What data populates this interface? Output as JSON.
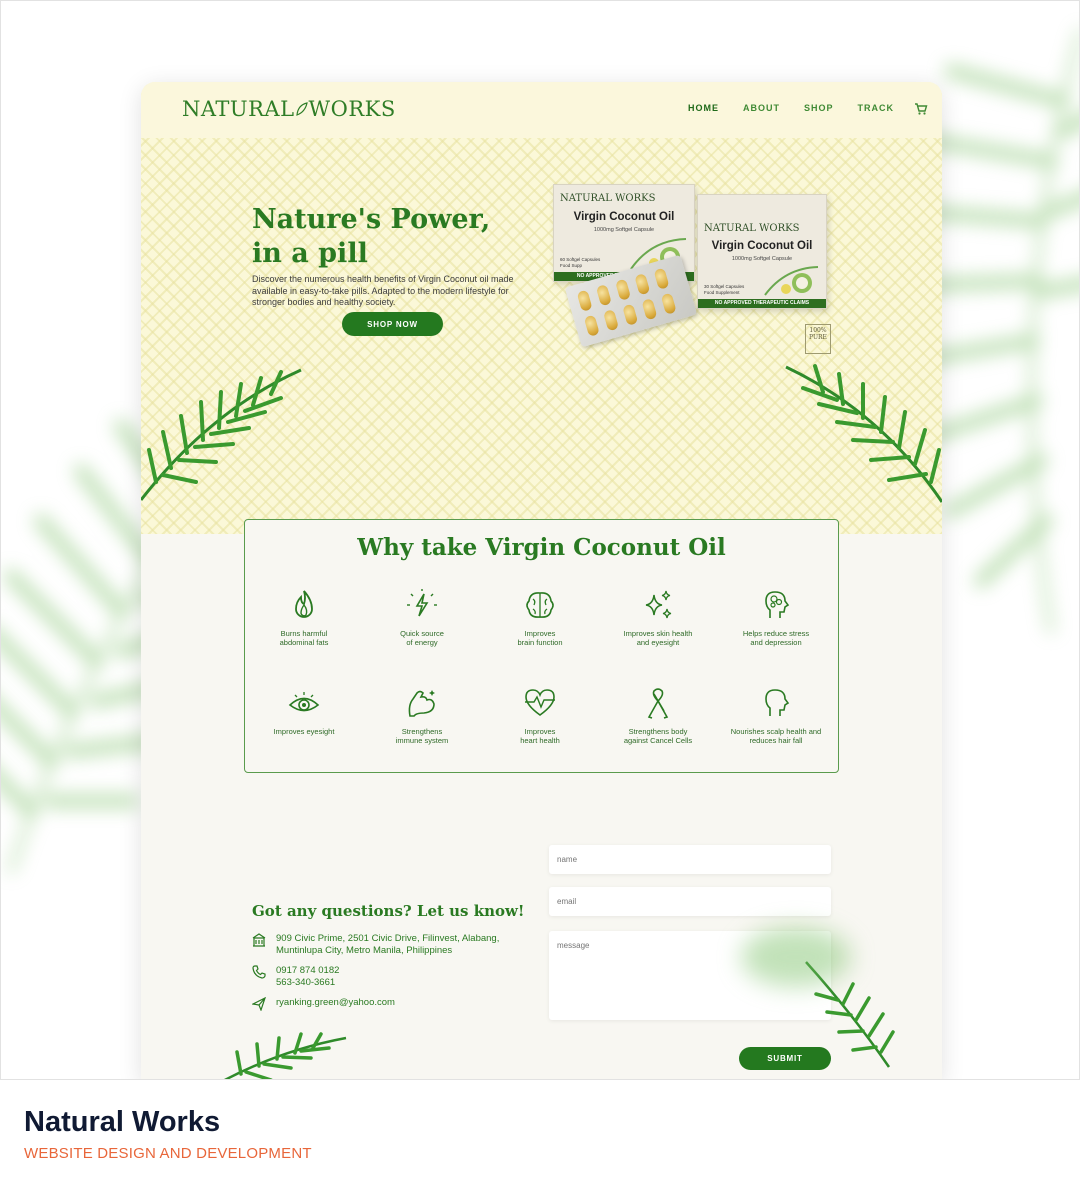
{
  "colors": {
    "brand_green": "#2a7a22",
    "button_green": "#24791f",
    "hero_bg": "#fbf8d8",
    "page_bg": "#f8f7f2",
    "accent_orange": "#e8663a"
  },
  "header": {
    "logo_text_left": "NATURAL",
    "logo_text_right": "WORKS",
    "nav": [
      "HOME",
      "ABOUT",
      "SHOP",
      "TRACK"
    ],
    "cart_icon": "cart-icon"
  },
  "hero": {
    "title_line1": "Nature's Power,",
    "title_line2": "in a pill",
    "description": "Discover the numerous health benefits of Virgin Coconut oil made available in easy-to-take pills. Adapted to the modern lifestyle for stronger bodies and healthy society.",
    "cta": "SHOP NOW"
  },
  "product_boxes": [
    {
      "brand": "NATURAL WORKS",
      "name": "Virgin Coconut Oil",
      "sub": "1000mg Softgel Capsule",
      "small": "60 Softgel Capsules\nFood Supp",
      "strip": "NO APPROVED THERAPEUTIC CLAIMS"
    },
    {
      "brand": "NATURAL WORKS",
      "name": "Virgin Coconut Oil",
      "sub": "1000mg Softgel Capsule",
      "small": "30 Softgel Capsules\nFood Supplement",
      "strip": "NO APPROVED THERAPEUTIC CLAIMS"
    }
  ],
  "badge": "100% PURE",
  "why": {
    "title": "Why take Virgin Coconut Oil",
    "benefits": [
      {
        "icon": "flame-icon",
        "label": "Burns harmful\nabdominal fats"
      },
      {
        "icon": "energy-icon",
        "label": "Quick source\nof energy"
      },
      {
        "icon": "brain-icon",
        "label": "Improves\nbrain function"
      },
      {
        "icon": "sparkle-icon",
        "label": "Improves skin health\nand eyesight"
      },
      {
        "icon": "head-stress-icon",
        "label": "Helps reduce stress\nand depression"
      },
      {
        "icon": "eye-icon",
        "label": "Improves eyesight"
      },
      {
        "icon": "muscle-icon",
        "label": "Strengthens\nimmune system"
      },
      {
        "icon": "heart-pulse-icon",
        "label": "Improves\nheart health"
      },
      {
        "icon": "ribbon-icon",
        "label": "Strengthens body\nagainst Cancel Cells"
      },
      {
        "icon": "head-profile-icon",
        "label": "Nourishes scalp health and\nreduces hair fall"
      }
    ]
  },
  "contact": {
    "title": "Got any questions? Let us know!",
    "address": "909 Civic Prime, 2501 Civic Drive, Filinvest, Alabang,\nMuntinlupa City, Metro Manila, Philippines",
    "phones": "0917 874 0182\n563-340-3661",
    "email": "ryanking.green@yahoo.com",
    "form": {
      "name_placeholder": "name",
      "email_placeholder": "email",
      "message_placeholder": "message",
      "submit": "SUBMIT"
    }
  },
  "footer": {
    "title": "Natural Works",
    "subtitle": "WEBSITE DESIGN AND DEVELOPMENT"
  }
}
